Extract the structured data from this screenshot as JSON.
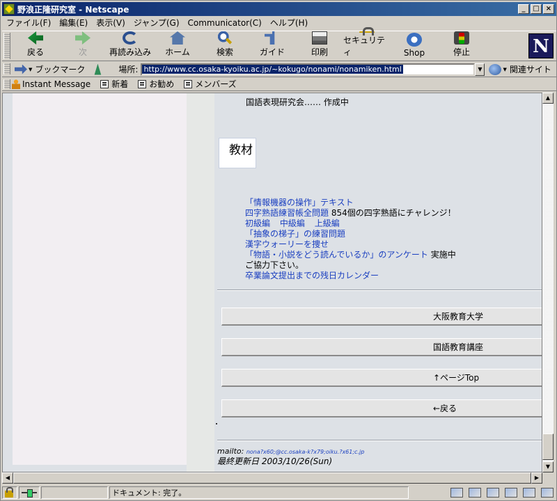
{
  "window": {
    "title": "野浪正隆研究室 - Netscape"
  },
  "menu": [
    "ファイル(F)",
    "編集(E)",
    "表示(V)",
    "ジャンプ(G)",
    "Communicator(C)",
    "ヘルプ(H)"
  ],
  "toolbar": {
    "back": "戻る",
    "forward": "次",
    "reload": "再読み込み",
    "home": "ホーム",
    "search": "検索",
    "guide": "ガイド",
    "print": "印刷",
    "security": "セキュリティ",
    "shop": "Shop",
    "stop": "停止",
    "logo": "N"
  },
  "location": {
    "bookmark": "ブックマーク",
    "label": "場所:",
    "url": "http://www.cc.osaka-kyoiku.ac.jp/~kokugo/nonami/nonamiken.html",
    "related": "関連サイト"
  },
  "personal": [
    "Instant Message",
    "新着",
    "お勧め",
    "メンバーズ"
  ],
  "page": {
    "top_line": "国語表現研究会…… 作成中",
    "section_title": "教材",
    "links": {
      "l1": "「情報機器の操作」テキスト",
      "l2_text": "四字熟語練習帳全問題",
      "l2_tail": " 854個の四字熟語にチャレンジ！",
      "l3a": "初級編",
      "l3b": "中級編",
      "l3c": "上級編",
      "l4": "「抽象の梯子」の練習問題",
      "l5": "漢字ウォーリーを捜せ",
      "l6_link": "「物語・小説をどう読んでいるか」のアンケート",
      "l6_tail": " 実施中",
      "l7": "ご協力下さい。",
      "l8": "卒業論文提出までの残日カレンダー"
    },
    "buttons": [
      "大阪教育大学",
      "国語教育講座",
      "↑ページTop",
      "←戻る"
    ],
    "mail_label": "mailto: ",
    "mail_addr": "nona?x60;@cc.osaka-k?x79;oiku.?x61;c.jp",
    "updated": "最終更新日  2003/10/26(Sun)"
  },
  "status": {
    "text": "ドキュメント: 完了。"
  }
}
